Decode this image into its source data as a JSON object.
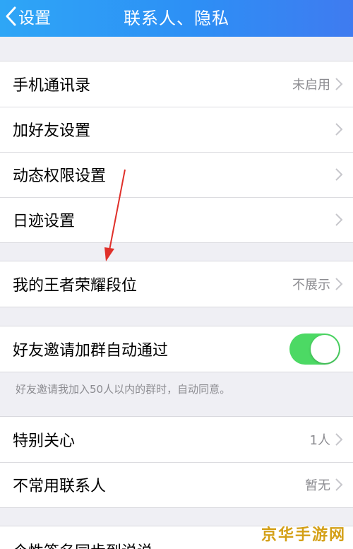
{
  "nav": {
    "back_label": "设置",
    "title": "联系人、隐私"
  },
  "group1": [
    {
      "label": "手机通讯录",
      "value": "未启用"
    },
    {
      "label": "加好友设置",
      "value": ""
    },
    {
      "label": "动态权限设置",
      "value": ""
    },
    {
      "label": "日迹设置",
      "value": ""
    }
  ],
  "group2": [
    {
      "label": "我的王者荣耀段位",
      "value": "不展示"
    }
  ],
  "group3": {
    "label": "好友邀请加群自动通过",
    "toggle_on": true,
    "footnote": "好友邀请我加入50人以内的群时，自动同意。"
  },
  "group4": [
    {
      "label": "特别关心",
      "value": "1人"
    },
    {
      "label": "不常用联系人",
      "value": "暂无"
    }
  ],
  "partial_row": {
    "label": "个性签名同步到说说"
  },
  "watermark": "京华手游网",
  "colors": {
    "nav_bg": "#2d8ff5",
    "toggle_on": "#4cd964",
    "annotation_arrow": "#e0302a"
  }
}
